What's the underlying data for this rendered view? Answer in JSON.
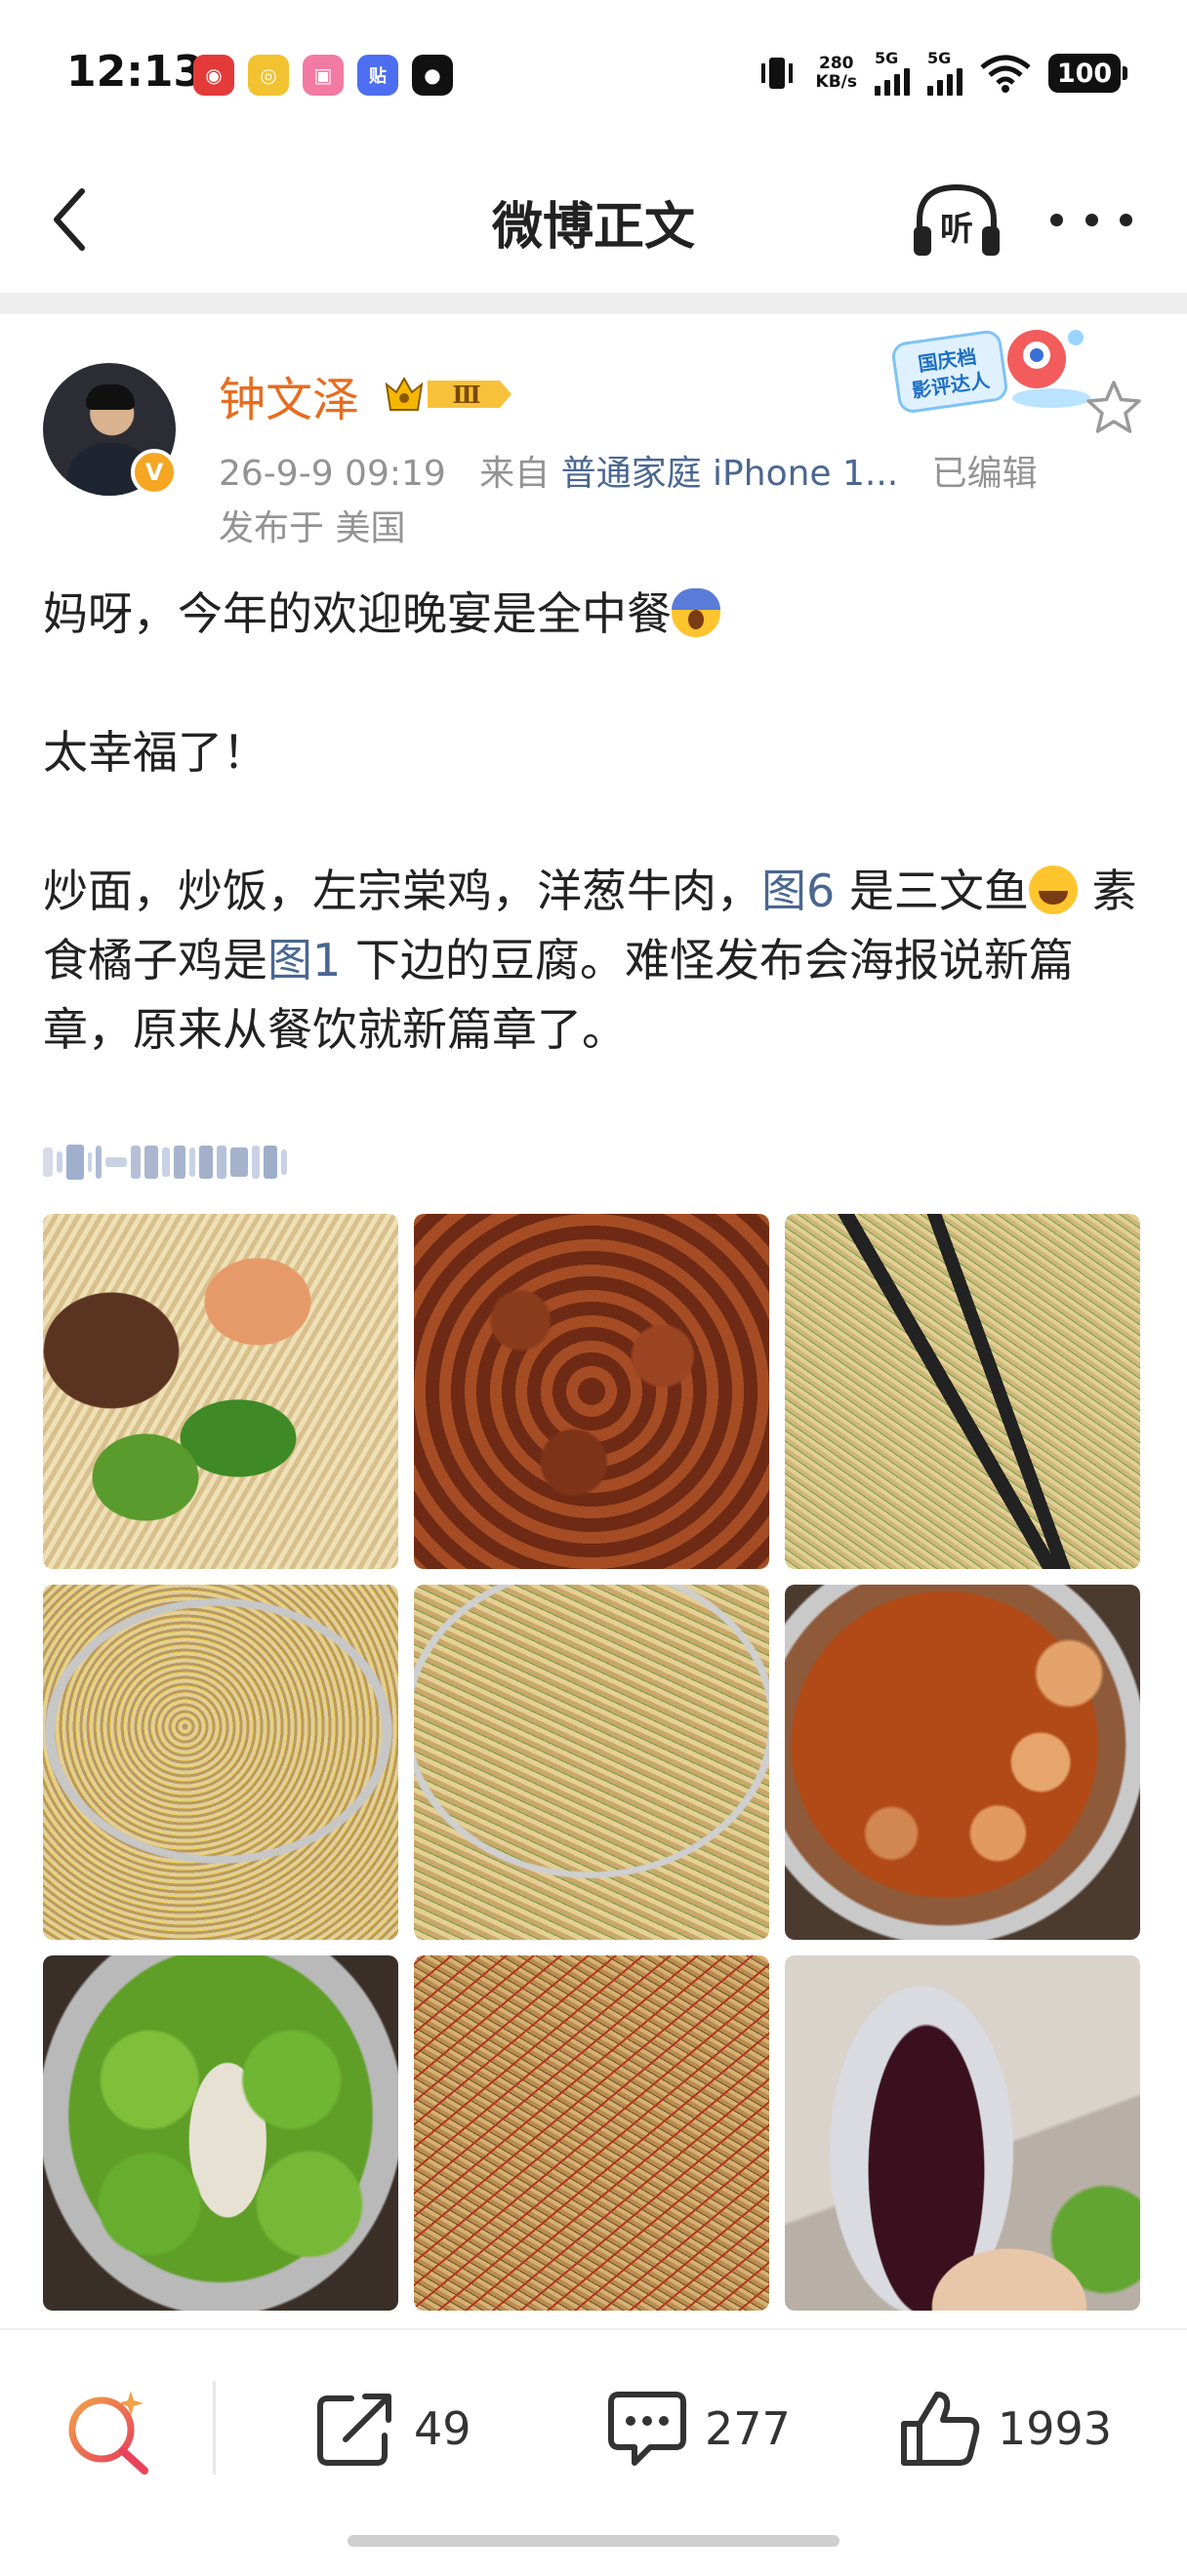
{
  "status_bar": {
    "time": "12:13",
    "app_icons": [
      {
        "name": "netease-music-icon",
        "color": "#e43a3a",
        "glyph": "◉"
      },
      {
        "name": "weibo-icon",
        "color": "#f2c230",
        "glyph": "◎"
      },
      {
        "name": "bilibili-icon",
        "color": "#f27aa3",
        "glyph": "▣"
      },
      {
        "name": "tieba-icon",
        "color": "#4e6ef2",
        "glyph": "贴"
      },
      {
        "name": "black-app-icon",
        "color": "#111111",
        "glyph": "●"
      }
    ],
    "net_speed_value": "280",
    "net_speed_unit": "KB/s",
    "signal1_label": "5G",
    "signal2_label": "5G",
    "battery": "100"
  },
  "nav": {
    "title": "微博正文",
    "listen_label": "听"
  },
  "post": {
    "author": "钟文泽",
    "level_badge": "Ⅲ",
    "verified_glyph": "V",
    "date": "26-9-9 09:19",
    "from_label": "来自",
    "device": "普通家庭 iPhone 1...",
    "edited": "已编辑",
    "location": "发布于 美国",
    "event_badge_line1": "国庆档",
    "event_badge_line2": "影评达人",
    "text": {
      "p1": "妈呀，今年的欢迎晚宴是全中餐",
      "p2": "太幸福了！",
      "p3_a": "炒面，炒饭，左宗棠鸡，洋葱牛肉，",
      "p3_link1": "图6",
      "p3_b": " 是三文鱼",
      "p3_c": " 素食橘子鸡是",
      "p3_link2": "图1",
      "p3_d": " 下边的豆腐。难怪发布会海报说新篇章，原来从餐饮就新篇章了。"
    },
    "photos": [
      {
        "name": "photo-plate-salmon-beef-noodles"
      },
      {
        "name": "photo-general-tso-chicken"
      },
      {
        "name": "photo-fried-noodles-tongs"
      },
      {
        "name": "photo-fried-rice"
      },
      {
        "name": "photo-chow-mein"
      },
      {
        "name": "photo-tofu"
      },
      {
        "name": "photo-broccoli"
      },
      {
        "name": "photo-onion-beef"
      },
      {
        "name": "photo-red-wine-glass"
      }
    ]
  },
  "actions": {
    "repost_count": "49",
    "comment_count": "277",
    "like_count": "1993"
  },
  "colors": {
    "accent_orange": "#e86c1f",
    "link_blue": "#4a6791",
    "meta_gray": "#939393"
  }
}
